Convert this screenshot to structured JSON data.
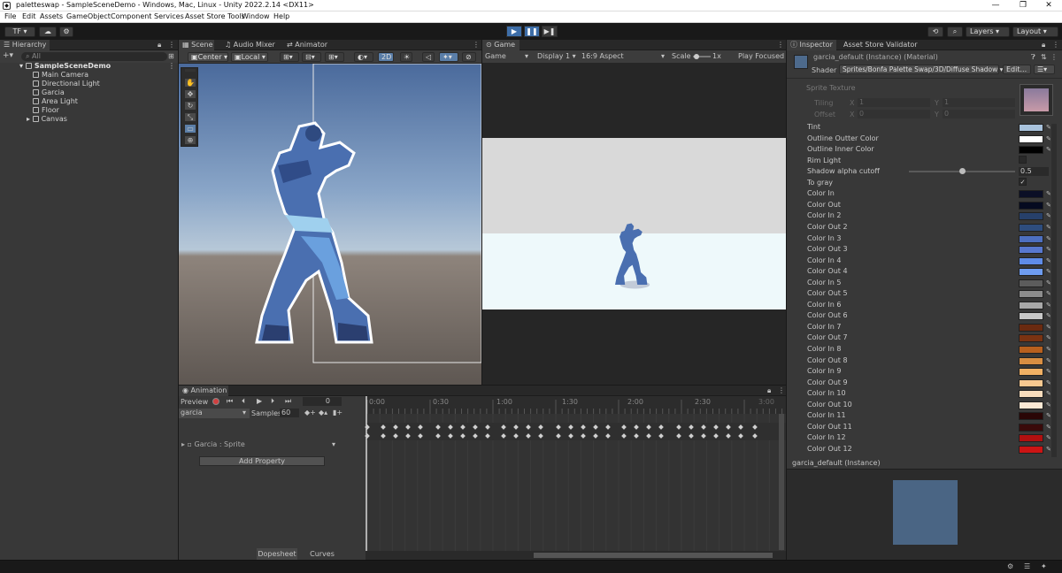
{
  "window": {
    "title": "paletteswap - SampleSceneDemo - Windows, Mac, Linux - Unity 2022.2.14 <DX11>",
    "minimize": "—",
    "restore": "❐",
    "close": "✕"
  },
  "menu": [
    "File",
    "Edit",
    "Assets",
    "GameObject",
    "Component",
    "Services",
    "Asset Store Tools",
    "Window",
    "Help"
  ],
  "toolbar": {
    "account": "TF ▾",
    "cloud_icon": "☁",
    "gear_icon": "⚙",
    "play": "▶",
    "pause": "❚❚",
    "step": "▶❚",
    "history": "⟲",
    "search": "⌕",
    "layers": "Layers",
    "layout": "Layout"
  },
  "hierarchy": {
    "tab": "Hierarchy",
    "search_placeholder": "All",
    "scene": "SampleSceneDemo",
    "items": [
      "Main Camera",
      "Directional Light",
      "Garcia",
      "Area Light",
      "Floor",
      "Canvas"
    ]
  },
  "scene_tabs": [
    "Scene",
    "Audio Mixer",
    "Animator"
  ],
  "scene_toolbar": {
    "pivot": "Center",
    "space": "Local",
    "mode2d": "2D"
  },
  "game": {
    "tab": "Game",
    "display_mode": "Game",
    "display": "Display 1",
    "aspect": "16:9 Aspect",
    "scale_label": "Scale",
    "scale_value": "1x",
    "play_focused": "Play Focused"
  },
  "animation": {
    "tab": "Animation",
    "preview": "Preview",
    "frame": "0",
    "clip": "garcia",
    "samples_label": "Samples",
    "samples": "60",
    "property": "Garcia : Sprite",
    "add_property": "Add Property",
    "dopesheet": "Dopesheet",
    "curves": "Curves",
    "ticks": [
      "0:00",
      "0:30",
      "1:00",
      "1:30",
      "2:00",
      "2:30",
      "3:00"
    ]
  },
  "inspector": {
    "tab": "Inspector",
    "tab2": "Asset Store Validator",
    "material_name": "garcia_default (Instance) (Material)",
    "shader_label": "Shader",
    "shader": "Sprites/Bonfa Palette Swap/3D/Diffuse Shadow",
    "edit": "Edit...",
    "sprite_texture": "Sprite Texture",
    "tiling": "Tiling",
    "offset": "Offset",
    "x": "X",
    "y": "Y",
    "tiling_x": "1",
    "tiling_y": "1",
    "offset_x": "0",
    "offset_y": "0",
    "shadow_value": "0.5",
    "shadow_fraction": 0.5,
    "to_gray_check": "✓",
    "properties": [
      {
        "label": "Tint",
        "color": "#a8c2dc"
      },
      {
        "label": "Outline Outter Color",
        "color": "#ffffff"
      },
      {
        "label": "Outline Inner Color",
        "color": "#000000"
      },
      {
        "label": "Rim Light",
        "color": ""
      },
      {
        "label": "Shadow alpha cutoff",
        "color": ""
      },
      {
        "label": "To gray",
        "color": ""
      },
      {
        "label": "Color In",
        "color": "#0b0f26"
      },
      {
        "label": "Color Out",
        "color": "#050a20"
      },
      {
        "label": "Color In 2",
        "color": "#27406a"
      },
      {
        "label": "Color Out 2",
        "color": "#2e4d7e"
      },
      {
        "label": "Color In 3",
        "color": "#4d6fc0"
      },
      {
        "label": "Color Out 3",
        "color": "#5878cf"
      },
      {
        "label": "Color In 4",
        "color": "#5f8ce8"
      },
      {
        "label": "Color Out 4",
        "color": "#6e9cf0"
      },
      {
        "label": "Color In 5",
        "color": "#5c5c5c"
      },
      {
        "label": "Color Out 5",
        "color": "#8c8c8c"
      },
      {
        "label": "Color In 6",
        "color": "#a8a8a8"
      },
      {
        "label": "Color Out 6",
        "color": "#c8c8c8"
      },
      {
        "label": "Color In 7",
        "color": "#6a2a10"
      },
      {
        "label": "Color Out 7",
        "color": "#7a3312"
      },
      {
        "label": "Color In 8",
        "color": "#b8601e"
      },
      {
        "label": "Color Out 8",
        "color": "#d88e42"
      },
      {
        "label": "Color In 9",
        "color": "#f0b064"
      },
      {
        "label": "Color Out 9",
        "color": "#f6c890"
      },
      {
        "label": "Color In 10",
        "color": "#f8dcbc"
      },
      {
        "label": "Color Out 10",
        "color": "#fbe8d4"
      },
      {
        "label": "Color In 11",
        "color": "#2a0606"
      },
      {
        "label": "Color Out 11",
        "color": "#3a0a0a"
      },
      {
        "label": "Color In 12",
        "color": "#b01010"
      },
      {
        "label": "Color Out 12",
        "color": "#cc1414"
      }
    ],
    "preview_title": "garcia_default (Instance)",
    "preview_color": "#4a6584"
  }
}
